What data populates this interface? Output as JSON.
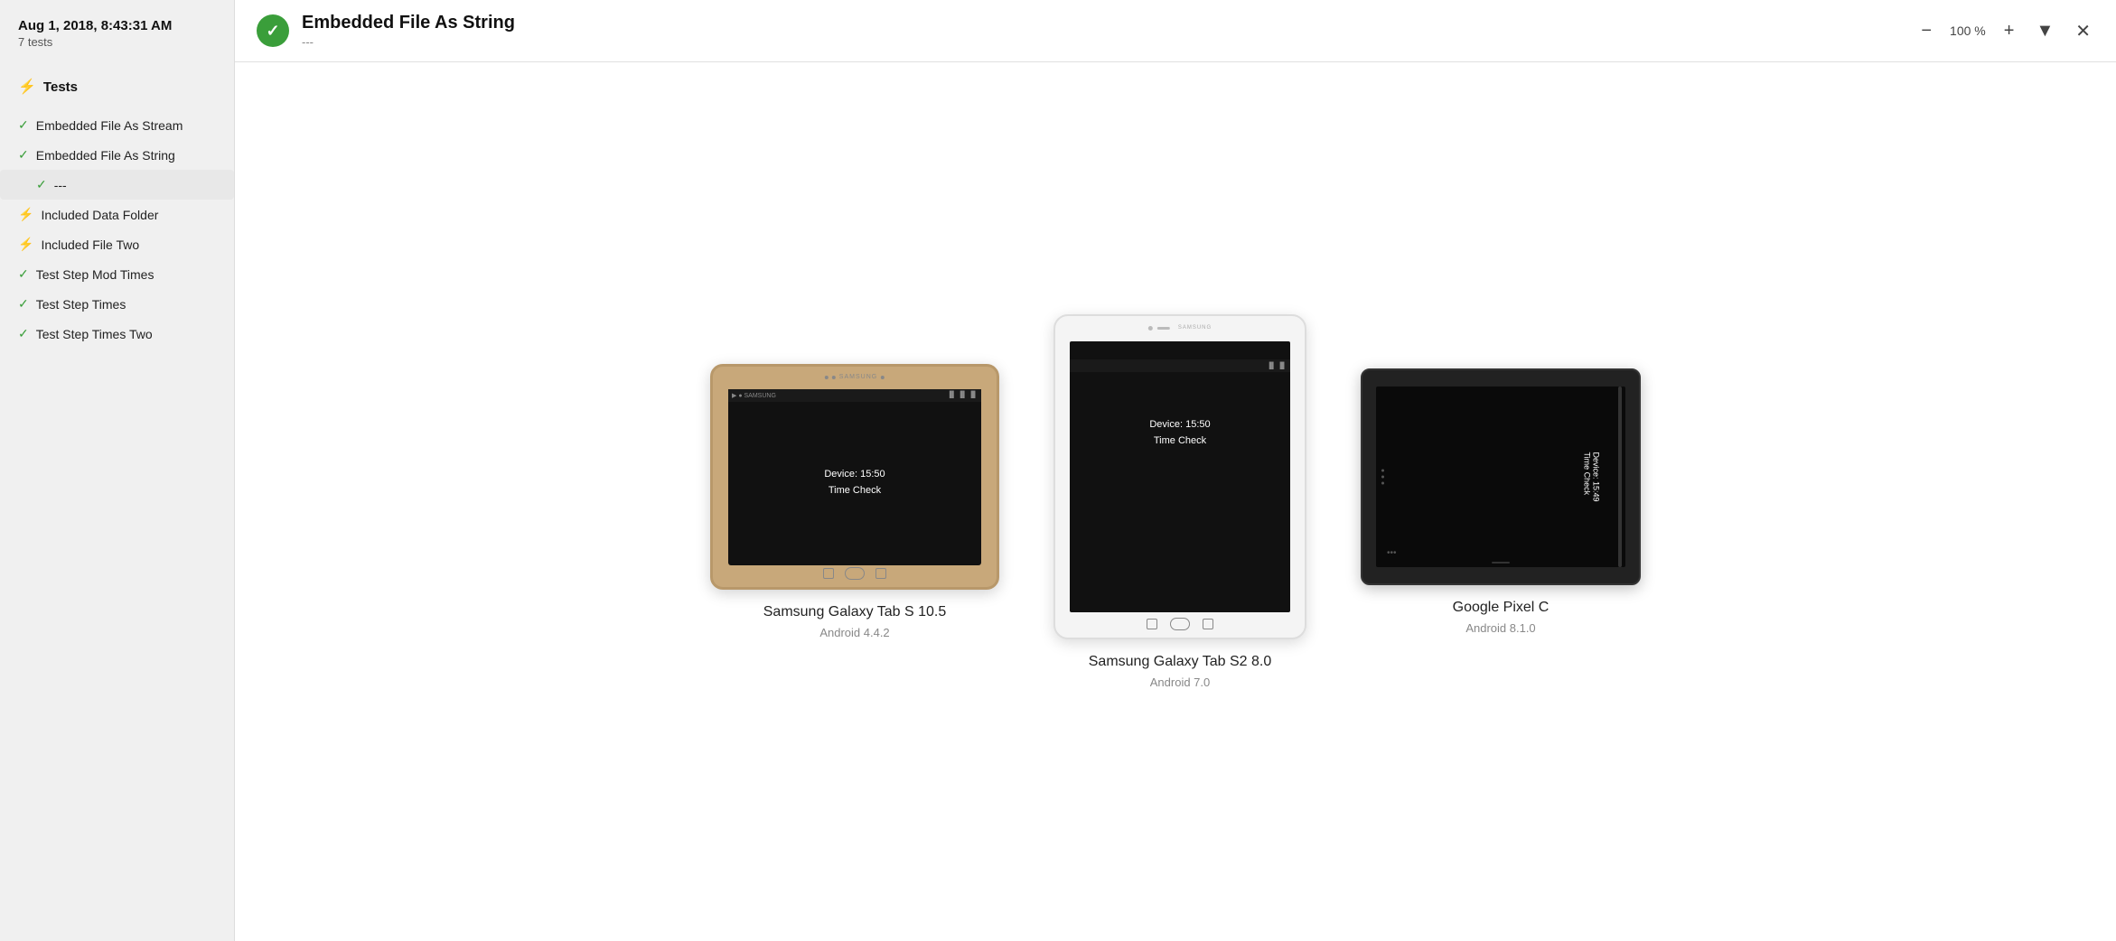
{
  "sidebar": {
    "date": "Aug 1, 2018, 8:43:31 AM",
    "test_count": "7 tests",
    "section_title": "Tests",
    "items": [
      {
        "id": "embedded-file-stream",
        "label": "Embedded File As Stream",
        "status": "pass",
        "active": false
      },
      {
        "id": "embedded-file-string",
        "label": "Embedded File As String",
        "status": "pass",
        "active": true
      },
      {
        "id": "embedded-file-string-sub",
        "label": "---",
        "status": "pass",
        "active": true,
        "sub": true
      },
      {
        "id": "included-data-folder",
        "label": "Included Data Folder",
        "status": "fail",
        "active": false
      },
      {
        "id": "included-file-two",
        "label": "Included File Two",
        "status": "fail",
        "active": false
      },
      {
        "id": "test-step-mod-times",
        "label": "Test Step Mod Times",
        "status": "pass",
        "active": false
      },
      {
        "id": "test-step-times",
        "label": "Test Step Times",
        "status": "pass",
        "active": false
      },
      {
        "id": "test-step-times-two",
        "label": "Test Step Times Two",
        "status": "pass",
        "active": false
      }
    ]
  },
  "header": {
    "title": "Embedded File As String",
    "subtitle": "---",
    "status": "pass",
    "zoom": "100 %"
  },
  "devices": [
    {
      "id": "samsung-galaxy-tab-s-105",
      "name": "Samsung Galaxy Tab S 10.5",
      "os": "Android 4.4.2",
      "type": "landscape",
      "screen_text_line1": "Device: 15:50",
      "screen_text_line2": "Time Check"
    },
    {
      "id": "samsung-galaxy-tab-s2-80",
      "name": "Samsung Galaxy Tab S2 8.0",
      "os": "Android 7.0",
      "type": "portrait-white",
      "screen_text_line1": "Device: 15:50",
      "screen_text_line2": "Time Check"
    },
    {
      "id": "google-pixel-c",
      "name": "Google Pixel C",
      "os": "Android 8.1.0",
      "type": "landscape-dark",
      "screen_text": "Device: 15:49\nTime Check"
    }
  ],
  "icons": {
    "zoom_out": "−",
    "zoom_in": "+",
    "filter": "▼",
    "close": "✕",
    "check": "✓",
    "lightning": "⚡"
  }
}
